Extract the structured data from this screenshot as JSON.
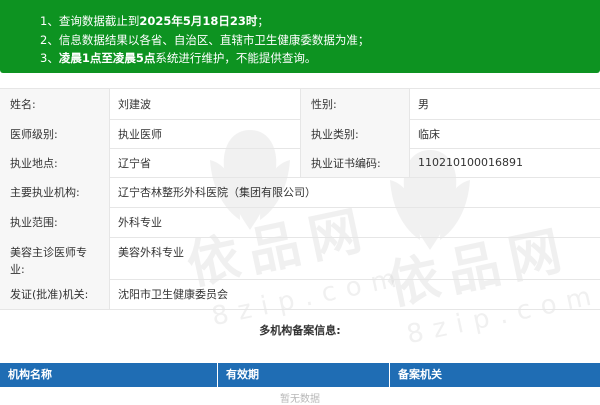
{
  "notice": {
    "line1_prefix": "1、查询数据截止到",
    "line1_bold": "2025年5月18日23时",
    "line1_suffix": "；",
    "line2": "2、信息数据结果以各省、自治区、直辖市卫生健康委数据为准；",
    "line3_prefix": "3、",
    "line3_bold1": "凌晨1点至凌晨5点",
    "line3_suffix": "系统进行维护，不能提供查询。"
  },
  "info": {
    "name_label": "姓名:",
    "name_value": "刘建波",
    "gender_label": "性别:",
    "gender_value": "男",
    "level_label": "医师级别:",
    "level_value": "执业医师",
    "category_label": "执业类别:",
    "category_value": "临床",
    "location_label": "执业地点:",
    "location_value": "辽宁省",
    "cert_label": "执业证书编码:",
    "cert_value": "110210100016891",
    "org_label": "主要执业机构:",
    "org_value": "辽宁杏林整形外科医院（集团有限公司）",
    "scope_label": "执业范围:",
    "scope_value": "外科专业",
    "cosmetic_label_line1": "美容主诊医师专",
    "cosmetic_label_line2": "业:",
    "cosmetic_value": "美容外科专业",
    "issuer_label": "发证(批准)机关:",
    "issuer_value": "沈阳市卫生健康委员会"
  },
  "multi_institution": {
    "title": "多机构备案信息:",
    "columns": [
      "机构名称",
      "有效期",
      "备案机关"
    ],
    "empty_text": "暂无数据"
  },
  "watermark": {
    "text": "依品网",
    "url": "8zip.com"
  },
  "colors": {
    "notice_bg": "#0d9321",
    "table_header_bg": "#1f6db4",
    "label_bg": "#f7f7f7"
  }
}
